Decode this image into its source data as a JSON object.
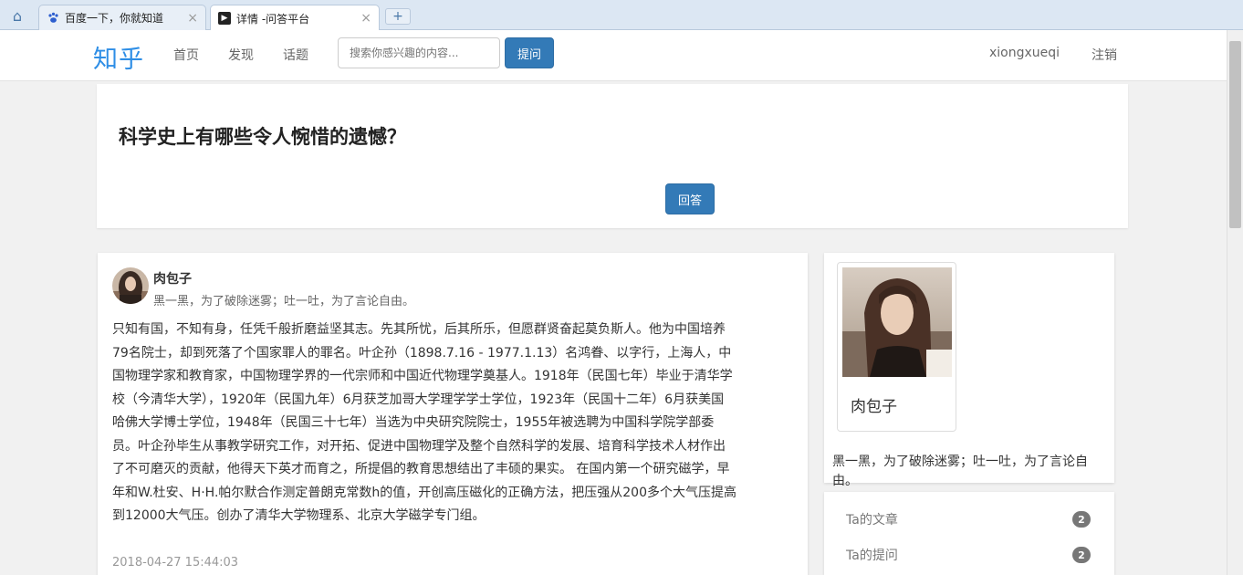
{
  "browser": {
    "tabs": [
      {
        "title": "百度一下，你就知道",
        "icon": "baidu-paw-icon"
      },
      {
        "title": "详情 -问答平台",
        "icon": "terminal-icon"
      }
    ],
    "close_glyph": "×",
    "new_tab_glyph": "+",
    "home_glyph": "⌂"
  },
  "navbar": {
    "brand": "知乎",
    "links": [
      "首页",
      "发现",
      "话题"
    ],
    "search_placeholder": "搜索你感兴趣的内容...",
    "ask_button": "提问",
    "username": "xiongxueqi",
    "logout": "注销"
  },
  "question": {
    "title": "科学史上有哪些令人惋惜的遗憾？",
    "answer_button": "回答"
  },
  "answer": {
    "author": "肉包子",
    "bio": "黑一黑，为了破除迷雾；吐一吐，为了言论自由。",
    "body": "只知有国，不知有身，任凭千般折磨益坚其志。先其所忧，后其所乐，但愿群贤奋起莫负斯人。他为中国培养79名院士，却到死落了个国家罪人的罪名。叶企孙（1898.7.16 - 1977.1.13）名鸿眷、以字行，上海人，中国物理学家和教育家，中国物理学界的一代宗师和中国近代物理学奠基人。1918年（民国七年）毕业于清华学校（今清华大学），1920年（民国九年）6月获芝加哥大学理学学士学位，1923年（民国十二年）6月获美国哈佛大学博士学位，1948年（民国三十七年）当选为中央研究院院士，1955年被选聘为中国科学院学部委员。叶企孙毕生从事教学研究工作，对开拓、促进中国物理学及整个自然科学的发展、培育科学技术人材作出了不可磨灭的贡献，他得天下英才而育之，所提倡的教育思想结出了丰硕的果实。 在国内第一个研究磁学，早年和W.杜安、H·H.帕尔默合作测定普朗克常数h的值，开创高压磁化的正确方法，把压强从200多个大气压提高到12000大气压。创办了清华大学物理系、北京大学磁学专门组。",
    "time": "2018-04-27 15:44:03"
  },
  "profile": {
    "name": "肉包子",
    "bio": "黑一黑，为了破除迷雾；吐一吐，为了言论自由。"
  },
  "stats": [
    {
      "label": "Ta的文章",
      "count": "2"
    },
    {
      "label": "Ta的提问",
      "count": "2"
    }
  ],
  "colors": {
    "primary": "#337ab7",
    "brand": "#2e8ee6",
    "badge": "#777777",
    "background": "#f1f1f1"
  }
}
